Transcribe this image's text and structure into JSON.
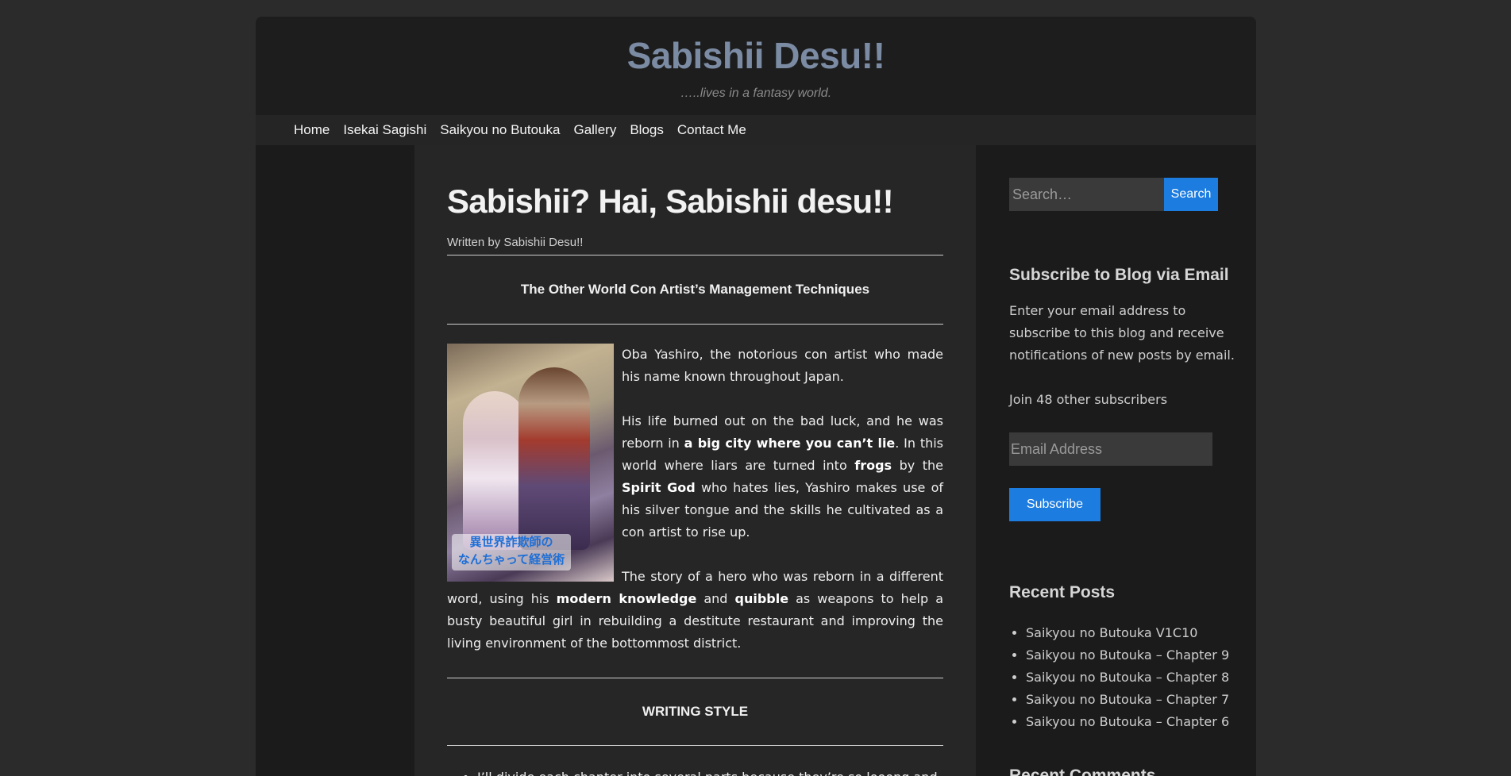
{
  "site": {
    "title": "Sabishii Desu!!",
    "tagline": "…..lives in a fantasy world."
  },
  "nav": {
    "items": [
      "Home",
      "Isekai Sagishi",
      "Saikyou no Butouka",
      "Gallery",
      "Blogs",
      "Contact Me"
    ]
  },
  "post": {
    "title": "Sabishii? Hai, Sabishii desu!!",
    "byline": "Written by Sabishii Desu!!",
    "section1_heading": "The Other World Con Artist’s Management Techniques",
    "cover_image": {
      "logo_line1": "異世界詐欺師の",
      "logo_line2": "なんちゃって経営術"
    },
    "p1": "Oba Yashiro, the notorious con artist who made his name known throughout Japan.",
    "p2": {
      "t1": "His life burned out on the bad luck, and he was reborn in ",
      "b1": "a big city where you can’t lie",
      "t2": ". In this world where liars are turned into ",
      "b2": "frogs",
      "t3": " by the ",
      "b3": "Spirit God",
      "t4": " who hates lies, Yashiro makes use of his silver tongue and the skills he cultivated as a con artist to rise up."
    },
    "p3": {
      "t1": "The story of a hero who was reborn in a different word, using his ",
      "b1": "modern knowledge",
      "t2": " and ",
      "b2": "quibble",
      "t3": " as weapons to help a busty beautiful girl in rebuilding a destitute restaurant and improving the living environment of the bottommost district."
    },
    "section2_heading": "WRITING STYLE",
    "bullet1": "I’ll divide each chapter into several parts because they’re so looong and"
  },
  "sidebar": {
    "search": {
      "placeholder": "Search…",
      "button": "Search"
    },
    "subscribe": {
      "title": "Subscribe to Blog via Email",
      "description": "Enter your email address to subscribe to this blog and receive notifications of new posts by email.",
      "subscribers": "Join 48 other subscribers",
      "email_placeholder": "Email Address",
      "button": "Subscribe"
    },
    "recent": {
      "title": "Recent Posts",
      "items": [
        "Saikyou no Butouka V1C10",
        "Saikyou no Butouka – Chapter 9",
        "Saikyou no Butouka – Chapter 8",
        "Saikyou no Butouka – Chapter 7",
        "Saikyou no Butouka – Chapter 6"
      ]
    },
    "next_widget_title": "Recent Comments"
  },
  "colors": {
    "background": "#2b2b2b",
    "title_accent": "#7b8ba3",
    "button_blue": "#1c7ce0"
  }
}
